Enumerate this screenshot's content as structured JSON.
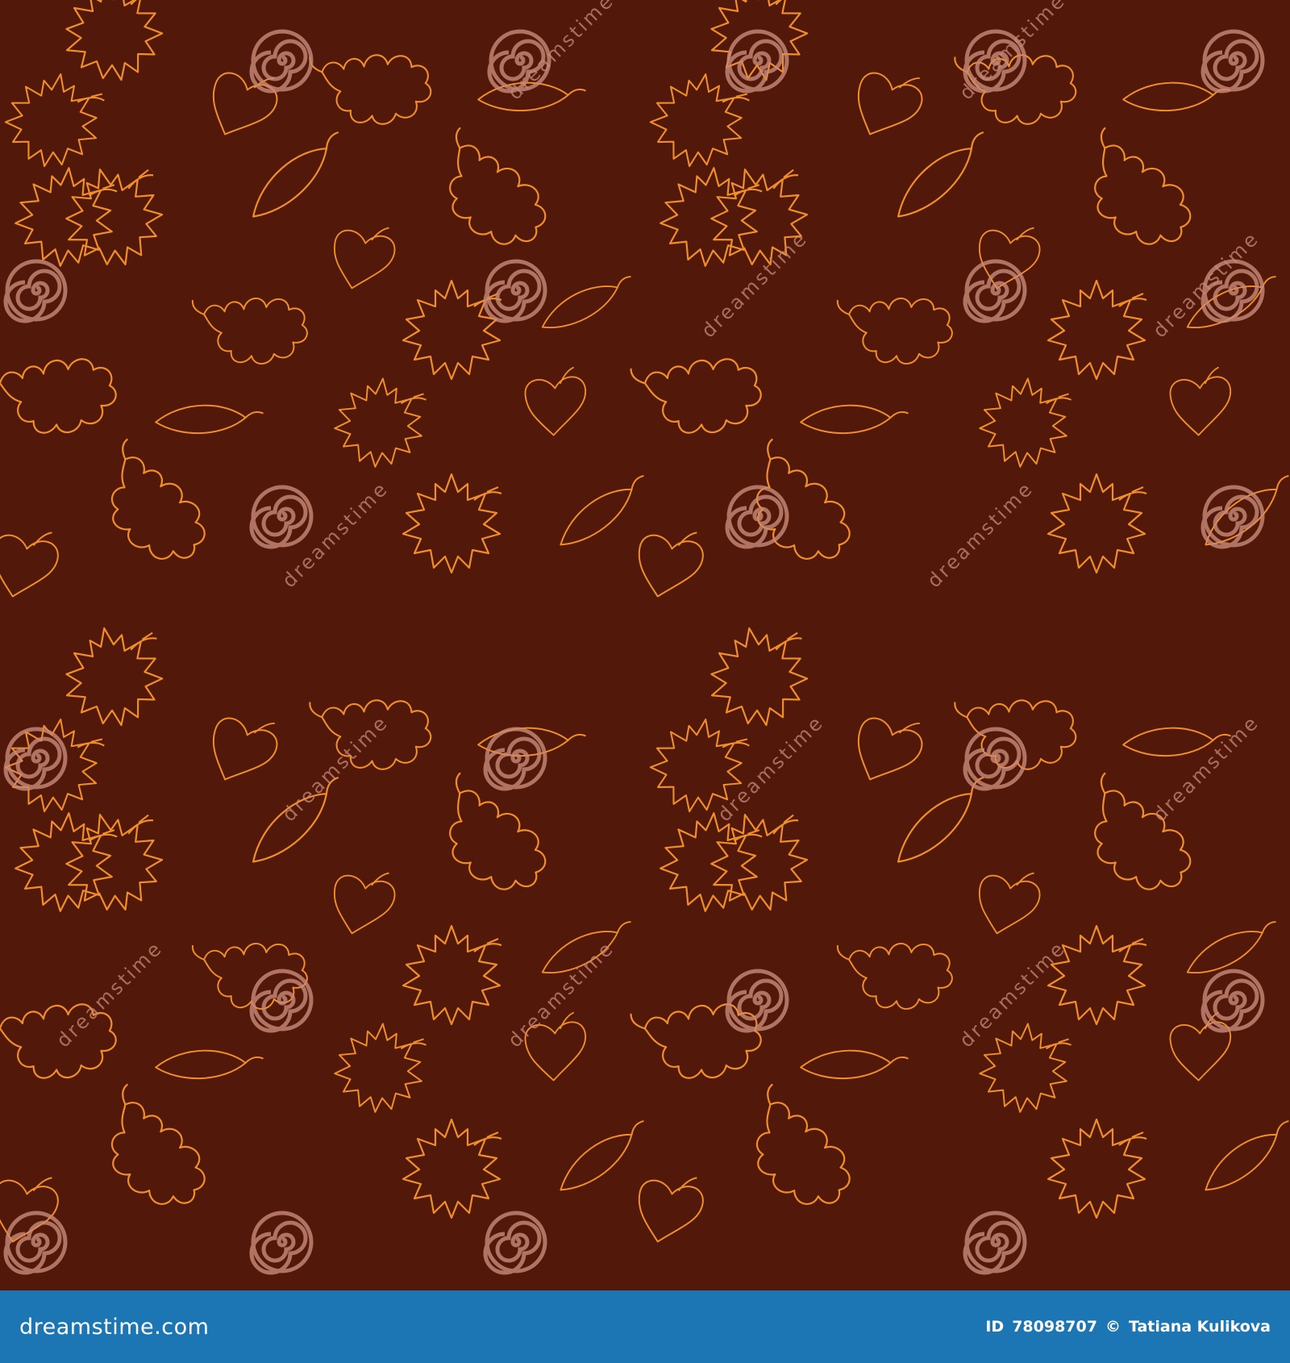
{
  "colors": {
    "background": "#52180a",
    "leaf_stroke": "#f08f2a",
    "watermark": "#c98a78",
    "footer_bar": "#1c76b4",
    "footer_text": "#ffffff"
  },
  "pattern": {
    "leaf_types": [
      "maple-leaf-icon",
      "oak-leaf-icon",
      "heart-leaf-icon",
      "willow-leaf-icon"
    ]
  },
  "watermark": {
    "spiral_icon": "spiral-icon",
    "text": "dreamstime"
  },
  "footer": {
    "logo_text": "dreamstime.com",
    "id_label": "ID",
    "id_value": "78098707",
    "copyright_symbol": "©",
    "author": "Tatiana Kulikova"
  }
}
